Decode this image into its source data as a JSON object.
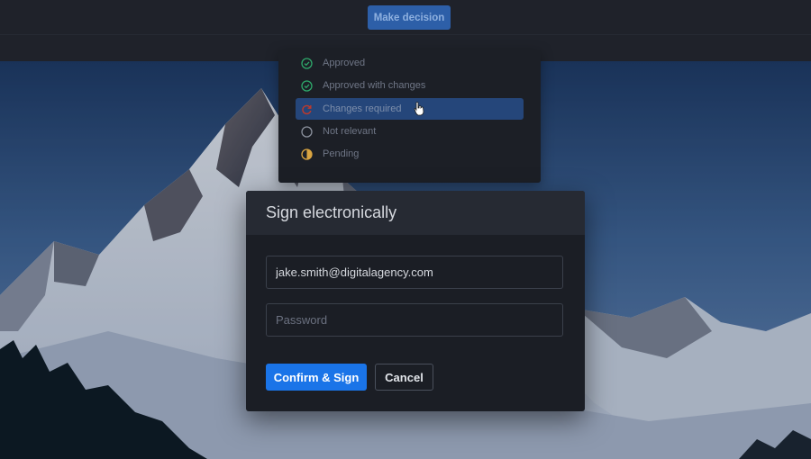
{
  "topbar": {
    "make_decision_label": "Make decision"
  },
  "decision_menu": {
    "items": [
      {
        "label": "Approved",
        "icon": "check-circle-icon",
        "color": "#2ea76a"
      },
      {
        "label": "Approved with changes",
        "icon": "check-circle-icon",
        "color": "#2ea76a"
      },
      {
        "label": "Changes required",
        "icon": "refresh-icon",
        "color": "#c0392b",
        "selected": true
      },
      {
        "label": "Not relevant",
        "icon": "empty-circle-icon",
        "color": "#8a909c"
      },
      {
        "label": "Pending",
        "icon": "half-circle-icon",
        "color": "#d9a441"
      }
    ]
  },
  "sign_dialog": {
    "title": "Sign electronically",
    "email_value": "jake.smith@digitalagency.com",
    "password_placeholder": "Password",
    "confirm_label": "Confirm & Sign",
    "cancel_label": "Cancel"
  },
  "colors": {
    "primary": "#1a74e8",
    "selected_item_bg": "#25467a"
  }
}
